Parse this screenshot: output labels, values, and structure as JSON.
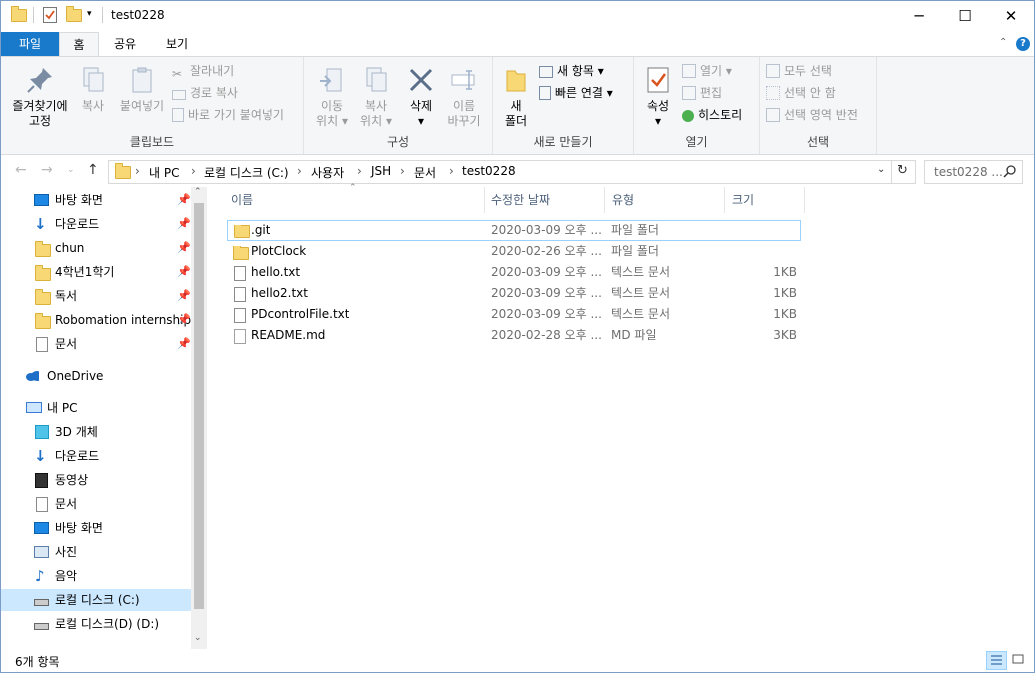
{
  "window": {
    "title": "test0228",
    "minimize": "─",
    "maximize": "☐",
    "close": "✕"
  },
  "tabs": {
    "file": "파일",
    "home": "홈",
    "share": "공유",
    "view": "보기"
  },
  "ribbon": {
    "clipboard": {
      "label": "클립보드",
      "pin_line1": "즐겨찾기에",
      "pin_line2": "고정",
      "copy": "복사",
      "paste": "붙여넣기",
      "cut": "잘라내기",
      "copy_path": "경로 복사",
      "paste_shortcut": "바로 가기 붙여넣기"
    },
    "organize": {
      "label": "구성",
      "move_line1": "이동",
      "move_line2": "위치",
      "copyto_line1": "복사",
      "copyto_line2": "위치",
      "delete": "삭제",
      "rename_line1": "이름",
      "rename_line2": "바꾸기"
    },
    "new": {
      "label": "새로 만들기",
      "folder_line1": "새",
      "folder_line2": "폴더",
      "new_item": "새 항목",
      "easy_access": "빠른 연결"
    },
    "open": {
      "label": "열기",
      "properties": "속성",
      "open": "열기",
      "edit": "편집",
      "history": "히스토리"
    },
    "select": {
      "label": "선택",
      "select_all": "모두 선택",
      "select_none": "선택 안 함",
      "invert": "선택 영역 반전"
    }
  },
  "address": {
    "crumbs": [
      "내 PC",
      "로컬 디스크 (C:)",
      "사용자",
      "JSH",
      "문서",
      "test0228"
    ],
    "search_placeholder": "test0228 ..."
  },
  "nav": {
    "quick": [
      {
        "label": "바탕 화면"
      },
      {
        "label": "다운로드"
      },
      {
        "label": "chun"
      },
      {
        "label": "4학년1학기"
      },
      {
        "label": "독서"
      },
      {
        "label": "Robomation internship"
      },
      {
        "label": "문서"
      }
    ],
    "onedrive": "OneDrive",
    "thispc": "내 PC",
    "pc": [
      {
        "label": "3D 개체"
      },
      {
        "label": "다운로드"
      },
      {
        "label": "동영상"
      },
      {
        "label": "문서"
      },
      {
        "label": "바탕 화면"
      },
      {
        "label": "사진"
      },
      {
        "label": "음악"
      },
      {
        "label": "로컬 디스크 (C:)"
      },
      {
        "label": "로컬 디스크(D) (D:)"
      }
    ]
  },
  "columns": {
    "name": "이름",
    "modified": "수정한 날짜",
    "type": "유형",
    "size": "크기"
  },
  "files": [
    {
      "name": ".git",
      "modified": "2020-03-09 오후 ...",
      "type": "파일 폴더",
      "size": "",
      "kind": "folder"
    },
    {
      "name": "PlotClock",
      "modified": "2020-02-26 오후 ...",
      "type": "파일 폴더",
      "size": "",
      "kind": "folder"
    },
    {
      "name": "hello.txt",
      "modified": "2020-03-09 오후 ...",
      "type": "텍스트 문서",
      "size": "1KB",
      "kind": "txt"
    },
    {
      "name": "hello2.txt",
      "modified": "2020-03-09 오후 ...",
      "type": "텍스트 문서",
      "size": "1KB",
      "kind": "txt"
    },
    {
      "name": "PDcontrolFile.txt",
      "modified": "2020-03-09 오후 ...",
      "type": "텍스트 문서",
      "size": "1KB",
      "kind": "txt"
    },
    {
      "name": "README.md",
      "modified": "2020-02-28 오후 ...",
      "type": "MD 파일",
      "size": "3KB",
      "kind": "file"
    }
  ],
  "status": {
    "count": "6개 항목"
  },
  "colors": {
    "accent": "#1979ca",
    "folder": "#f8d775",
    "selection": "#cce8ff"
  }
}
